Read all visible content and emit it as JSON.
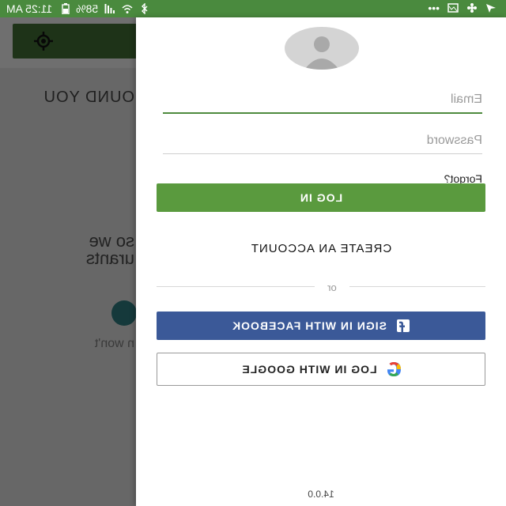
{
  "status_bar": {
    "time": "11:25 AM",
    "battery": "58%"
  },
  "background": {
    "heading_fragment": "OUND YOU",
    "line1_fragment": "so we",
    "line2_fragment": "urants",
    "line3_fragment": "n won't"
  },
  "drawer": {
    "email_placeholder": "Email",
    "password_placeholder": "Password",
    "forgot_label": "Forgot?",
    "login_label": "LOG IN",
    "create_account_label": "CREATE AN ACCOUNT",
    "or_label": "or",
    "facebook_label": "SIGN IN WITH FACEBOOK",
    "google_label": "LOG IN WITH GOOGLE",
    "version": "14.0.0"
  },
  "colors": {
    "brand_green": "#5a9a3e",
    "facebook_blue": "#3b5998"
  }
}
